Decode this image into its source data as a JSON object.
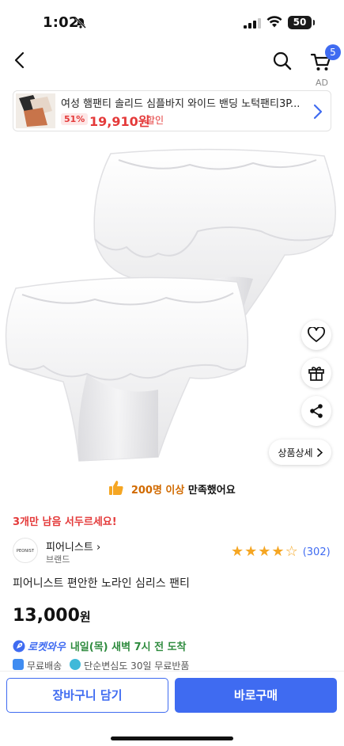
{
  "status": {
    "time": "1:02",
    "battery": "50"
  },
  "nav": {
    "cart_count": "5",
    "ad_label": "AD"
  },
  "ad": {
    "title": "여성 햄팬티 솔리드 심플바지 와이드 밴딩 노턱팬티3P...",
    "discount": "51%",
    "price": "19,910원",
    "sale_label": "할인"
  },
  "product": {
    "detail_button": "상품상세",
    "satisfaction_count": "200명 이상",
    "satisfaction_suffix": "만족했어요",
    "hurry": "3개만 남음 서두르세요!",
    "brand_logo_text": "PEONIST",
    "brand_name": "피어니스트",
    "brand_tag": "브랜드",
    "rating": 4,
    "review_count": "(302)",
    "title": "피어니스트 편안한 노라인 심리스 팬티",
    "price": "13,000",
    "price_unit": "원",
    "rocket_label": "로켓와우",
    "delivery": "내일(목) 새벽 7시 전 도착",
    "shipping": "무료배송",
    "returns": "단순변심도 30일 무료반품"
  },
  "bottom": {
    "cart_button": "장바구니 담기",
    "buy_button": "바로구매"
  },
  "colors": {
    "accent": "#3f6bf1",
    "sale": "#e43a3a",
    "star": "#f5a623",
    "delivery": "#2e8b3e"
  }
}
